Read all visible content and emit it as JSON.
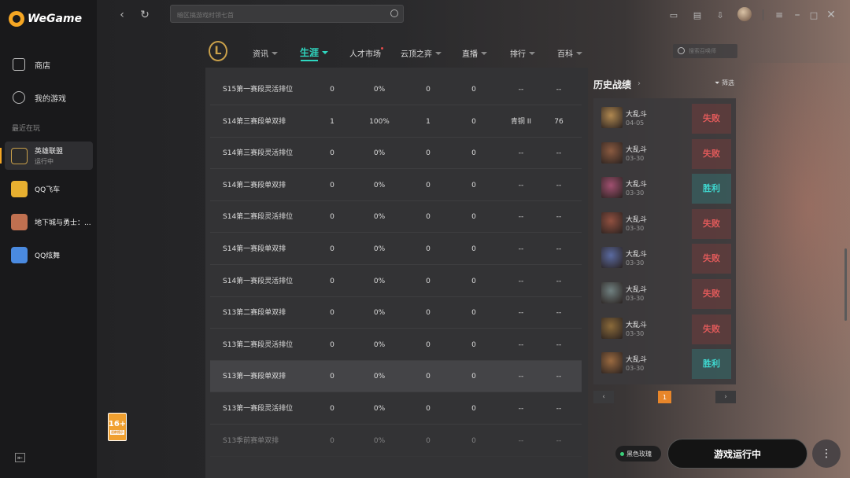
{
  "app": {
    "logo_text": "WeGame"
  },
  "sidebar": {
    "nav": [
      {
        "label": "商店",
        "icon": "shop-icon"
      },
      {
        "label": "我的游戏",
        "icon": "games-icon"
      }
    ],
    "recent_label": "最近在玩",
    "games": [
      {
        "name": "英雄联盟",
        "status": "运行中",
        "color": "#c9a04a"
      },
      {
        "name": "QQ飞车",
        "status": "",
        "color": "#e8b030"
      },
      {
        "name": "地下城与勇士：...",
        "status": "",
        "color": "#c07050"
      },
      {
        "name": "QQ炫舞",
        "status": "",
        "color": "#4a8ae0"
      }
    ]
  },
  "topbar": {
    "search_placeholder": "暗区搞游戏时领七首"
  },
  "game_nav": {
    "items": [
      "资讯",
      "生涯",
      "人才市场",
      "云顶之弈",
      "直播",
      "排行",
      "百科"
    ],
    "search_placeholder": "搜索召唤师"
  },
  "table": {
    "rows": [
      [
        "S15第一赛段灵活排位",
        "0",
        "0%",
        "0",
        "0",
        "--",
        "--"
      ],
      [
        "S14第三赛段单双排",
        "1",
        "100%",
        "1",
        "0",
        "青铜 II",
        "76"
      ],
      [
        "S14第三赛段灵活排位",
        "0",
        "0%",
        "0",
        "0",
        "--",
        "--"
      ],
      [
        "S14第二赛段单双排",
        "0",
        "0%",
        "0",
        "0",
        "--",
        "--"
      ],
      [
        "S14第二赛段灵活排位",
        "0",
        "0%",
        "0",
        "0",
        "--",
        "--"
      ],
      [
        "S14第一赛段单双排",
        "0",
        "0%",
        "0",
        "0",
        "--",
        "--"
      ],
      [
        "S14第一赛段灵活排位",
        "0",
        "0%",
        "0",
        "0",
        "--",
        "--"
      ],
      [
        "S13第二赛段单双排",
        "0",
        "0%",
        "0",
        "0",
        "--",
        "--"
      ],
      [
        "S13第二赛段灵活排位",
        "0",
        "0%",
        "0",
        "0",
        "--",
        "--"
      ],
      [
        "S13第一赛段单双排",
        "0",
        "0%",
        "0",
        "0",
        "--",
        "--"
      ],
      [
        "S13第一赛段灵活排位",
        "0",
        "0%",
        "0",
        "0",
        "--",
        "--"
      ],
      [
        "S13季前赛单双排",
        "0",
        "0%",
        "0",
        "0",
        "--",
        "--"
      ]
    ]
  },
  "history": {
    "title": "历史战绩",
    "filter_label": "筛选",
    "matches": [
      {
        "mode": "大乱斗",
        "date": "04-05",
        "result": "失败",
        "win": false,
        "color": "#b08850"
      },
      {
        "mode": "大乱斗",
        "date": "03-30",
        "result": "失败",
        "win": false,
        "color": "#8a5a40"
      },
      {
        "mode": "大乱斗",
        "date": "03-30",
        "result": "胜利",
        "win": true,
        "color": "#a05070"
      },
      {
        "mode": "大乱斗",
        "date": "03-30",
        "result": "失败",
        "win": false,
        "color": "#905040"
      },
      {
        "mode": "大乱斗",
        "date": "03-30",
        "result": "失败",
        "win": false,
        "color": "#5a6aa0"
      },
      {
        "mode": "大乱斗",
        "date": "03-30",
        "result": "失败",
        "win": false,
        "color": "#708080"
      },
      {
        "mode": "大乱斗",
        "date": "03-30",
        "result": "失败",
        "win": false,
        "color": "#8a6a3a"
      },
      {
        "mode": "大乱斗",
        "date": "03-30",
        "result": "胜利",
        "win": true,
        "color": "#9a6a40"
      }
    ],
    "page": "1"
  },
  "bottom": {
    "age_rating": "16+",
    "age_note": "适龄提示",
    "status": "黑色玫瑰",
    "run_label": "游戏运行中"
  }
}
